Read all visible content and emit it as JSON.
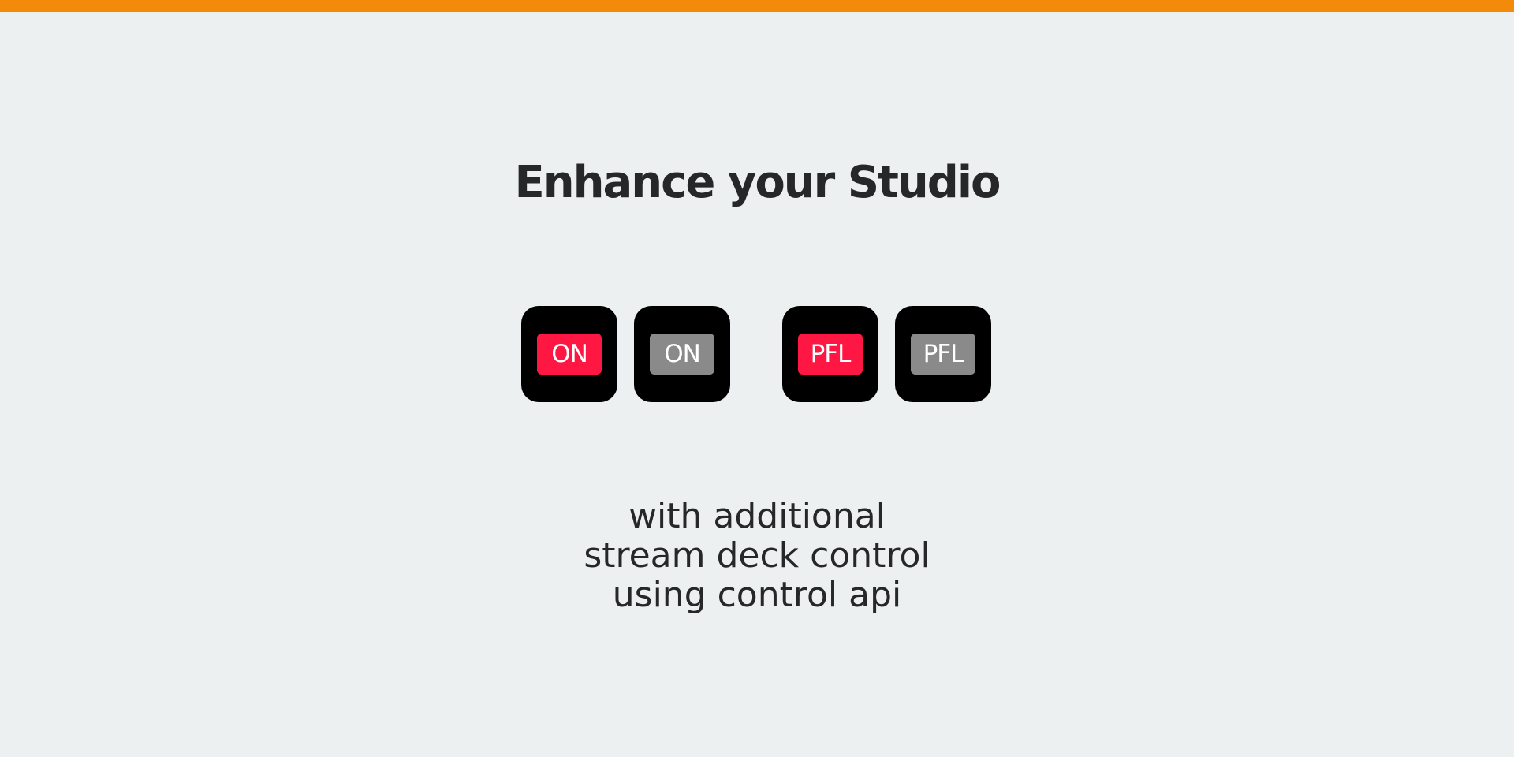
{
  "colors": {
    "accent_bar": "#f48a0a",
    "background": "#edf0f1",
    "text": "#262728",
    "key_background": "#000000",
    "active": "#ff1744",
    "inactive": "#8a8a8a"
  },
  "headline": "Enhance your Studio",
  "keys": [
    {
      "label": "ON",
      "state": "active",
      "color": "#ff1744"
    },
    {
      "label": "ON",
      "state": "inactive",
      "color": "#8a8a8a"
    },
    {
      "label": "PFL",
      "state": "active",
      "color": "#ff1744"
    },
    {
      "label": "PFL",
      "state": "inactive",
      "color": "#8a8a8a"
    }
  ],
  "subtitle": {
    "line1": "with additional",
    "line2": "stream deck control",
    "line3": "using control api"
  }
}
